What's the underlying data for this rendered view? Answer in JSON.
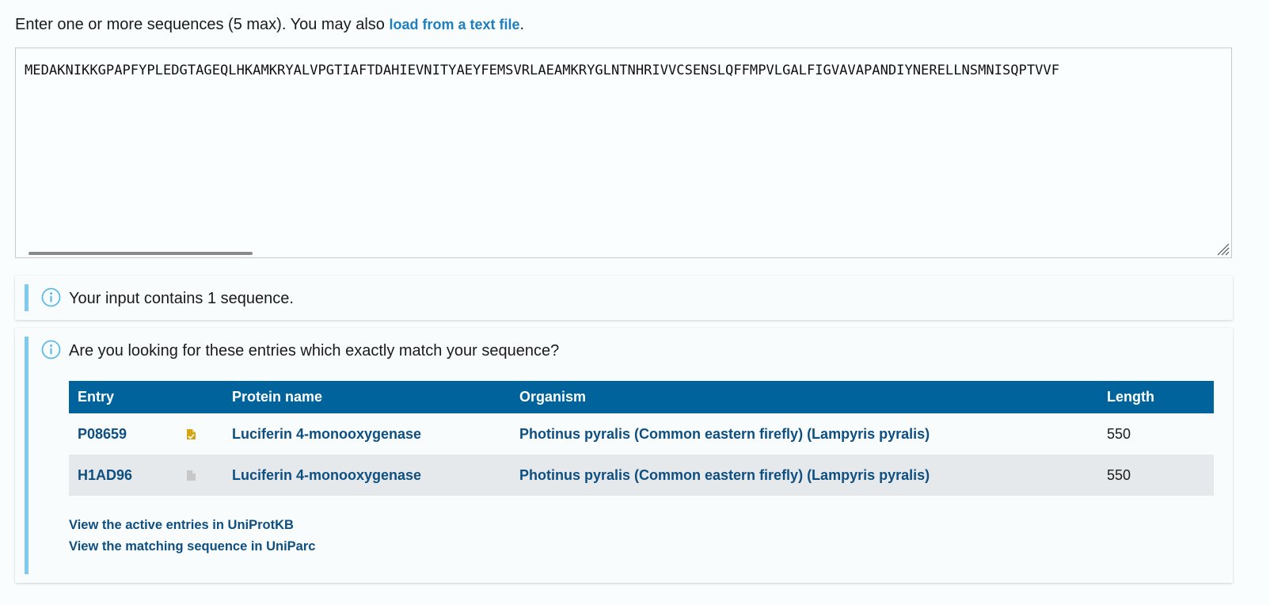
{
  "intro": {
    "text": "Enter one or more sequences (5 max). You may also ",
    "link": "load from a text file",
    "suffix": "."
  },
  "sequence": {
    "value": "MEDAKNIKKGPAPFYPLEDGTAGEQLHKAMKRYALVPGTIAFTDAHIEVNITYAEYFEMSVRLAEAMKRYGLNTNHRIVVCSENSLQFFMPVLGALFIGVAVAPANDIYNERELLNSMNISQPTVVF"
  },
  "notice_count": {
    "text": "Your input contains 1 sequence."
  },
  "notice_matches": {
    "text": "Are you looking for these entries which exactly match your sequence?",
    "columns": [
      "Entry",
      "Protein name",
      "Organism",
      "Length"
    ],
    "rows": [
      {
        "entry": "P08659",
        "status_icon": "reviewed-document-icon",
        "protein": "Luciferin 4-monooxygenase",
        "organism": "Photinus pyralis (Common eastern firefly) (Lampyris pyralis)",
        "length": "550"
      },
      {
        "entry": "H1AD96",
        "status_icon": "unreviewed-document-icon",
        "protein": "Luciferin 4-monooxygenase",
        "organism": "Photinus pyralis (Common eastern firefly) (Lampyris pyralis)",
        "length": "550"
      }
    ],
    "links": [
      "View the active entries in UniProtKB",
      "View the matching sequence in UniParc"
    ]
  },
  "colors": {
    "table_header": "#00639b",
    "link": "#0e4f80",
    "accent_link": "#1d7fc0",
    "notice_bar": "#7fcbef",
    "reviewed_icon": "#d4a514",
    "unreviewed_icon": "#c8c8c8"
  }
}
